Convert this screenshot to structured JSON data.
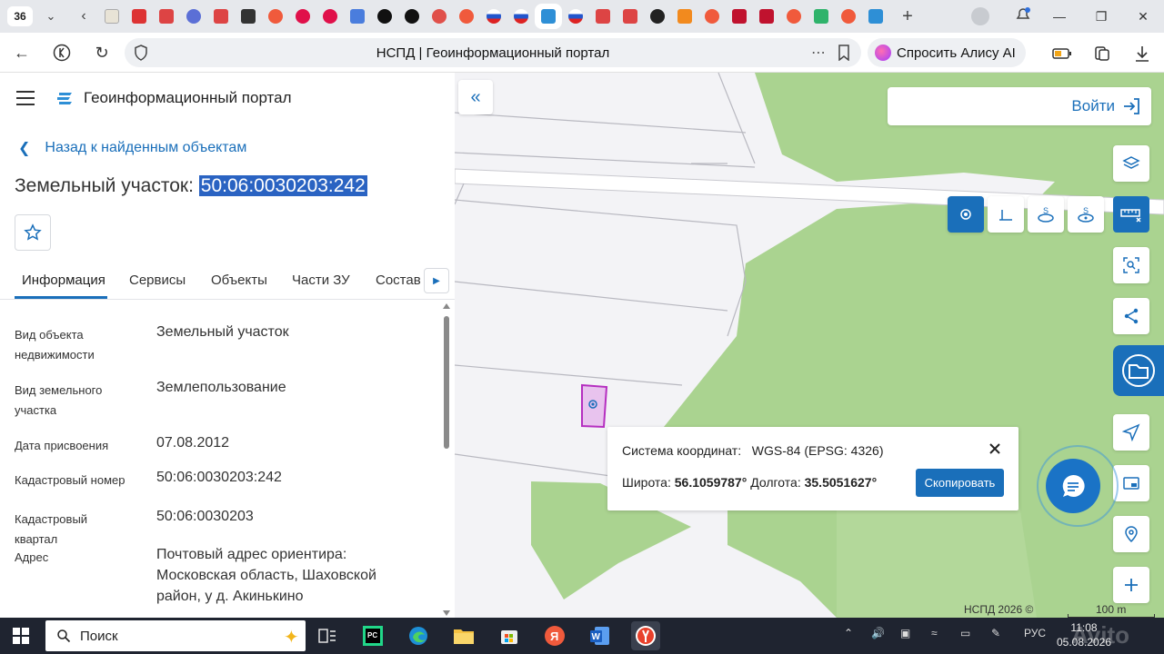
{
  "browser": {
    "tab_count": "36",
    "page_title": "НСПД | Геоинформационный портал",
    "alisa_label": "Спросить Алису AI"
  },
  "header": {
    "portal_title": "Геоинформационный портал"
  },
  "panel": {
    "back_label": "Назад к найденным объектам",
    "title_prefix": "Земельный участок:",
    "title_number": "50:06:0030203:242",
    "tabs": [
      "Информация",
      "Сервисы",
      "Объекты",
      "Части ЗУ",
      "Состав"
    ],
    "properties": [
      {
        "label": "Вид объекта недвижимости",
        "value": "Земельный участок"
      },
      {
        "label": "Вид земельного участка",
        "value": "Землепользование"
      },
      {
        "label": "Дата присвоения",
        "value": "07.08.2012"
      },
      {
        "label": "Кадастровый номер",
        "value": "50:06:0030203:242"
      },
      {
        "label": "Кадастровый квартал",
        "value": "50:06:0030203"
      },
      {
        "label": "Адрес",
        "value": "Почтовый адрес ориентира: Московская область, Шаховской район, у д. Акинькино"
      }
    ]
  },
  "map": {
    "login_label": "Войти",
    "popup": {
      "system_label": "Система координат:",
      "system_value": "WGS-84 (EPSG: 4326)",
      "lat_label": "Широта:",
      "lat_value": "56.1059787°",
      "lon_label": "Долгота:",
      "lon_value": "35.5051627°",
      "copy_label": "Скопировать"
    },
    "attribution": "НСПД 2026 ©",
    "scale_label": "100 m",
    "watermark": "Avito"
  },
  "taskbar": {
    "search_label": "Поиск",
    "lang": "РУС",
    "time": "11:08",
    "date": "05.08.2026"
  },
  "colors": {
    "accent": "#1a6fba",
    "forest": "#a9d28f",
    "selection": "#2a63c2",
    "parcel": "#c23cc4"
  }
}
